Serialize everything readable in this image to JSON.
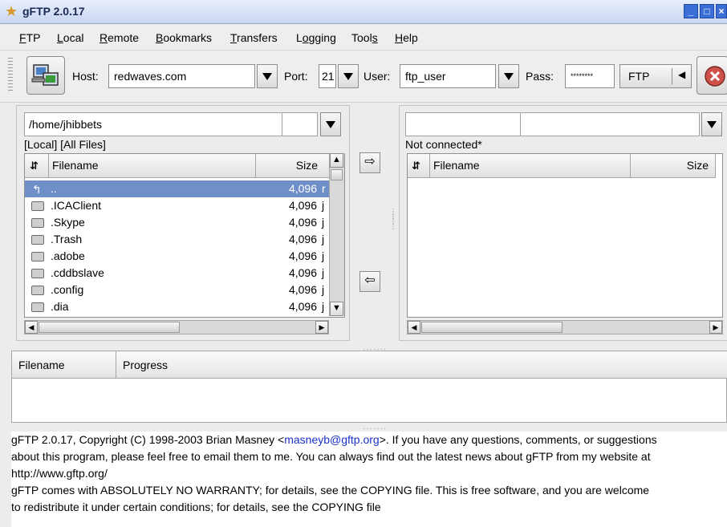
{
  "window": {
    "title": "gFTP 2.0.17",
    "app_icon": "star-icon",
    "buttons": [
      "minimize",
      "maximize",
      "close"
    ]
  },
  "menu": [
    {
      "label": "FTP",
      "key": "F"
    },
    {
      "label": "Local",
      "key": "L"
    },
    {
      "label": "Remote",
      "key": "R"
    },
    {
      "label": "Bookmarks",
      "key": "B"
    },
    {
      "label": "Transfers",
      "key": "T"
    },
    {
      "label": "Logging",
      "key": "o"
    },
    {
      "label": "Tools",
      "key": "s"
    },
    {
      "label": "Help",
      "key": "H"
    }
  ],
  "toolbar": {
    "connect_icon": "computer-connect-icon",
    "host_label": "Host:",
    "host_value": "redwaves.com",
    "port_label": "Port:",
    "port_value": "21",
    "user_label": "User:",
    "user_value": "ftp_user",
    "pass_label": "Pass:",
    "pass_value": "********",
    "protocol": "FTP",
    "stop_icon": "stop-icon"
  },
  "local": {
    "path": "/home/jhibbets",
    "status": "[Local] [All Files]",
    "columns": [
      "Filename",
      "Size"
    ],
    "files": [
      {
        "name": "..",
        "size": "4,096",
        "extra": "r",
        "type": "updir",
        "selected": true
      },
      {
        "name": ".ICAClient",
        "size": "4,096",
        "extra": "j",
        "type": "folder"
      },
      {
        "name": ".Skype",
        "size": "4,096",
        "extra": "j",
        "type": "folder"
      },
      {
        "name": ".Trash",
        "size": "4,096",
        "extra": "j",
        "type": "folder"
      },
      {
        "name": ".adobe",
        "size": "4,096",
        "extra": "j",
        "type": "folder"
      },
      {
        "name": ".cddbslave",
        "size": "4,096",
        "extra": "j",
        "type": "folder"
      },
      {
        "name": ".config",
        "size": "4,096",
        "extra": "j",
        "type": "folder"
      },
      {
        "name": ".dia",
        "size": "4,096",
        "extra": "j",
        "type": "folder"
      }
    ]
  },
  "remote": {
    "path": "",
    "status": "Not connected*",
    "columns": [
      "Filename",
      "Size"
    ]
  },
  "transfer_buttons": {
    "upload_icon": "arrow-right-icon",
    "download_icon": "arrow-left-icon"
  },
  "transfers": {
    "columns": [
      "Filename",
      "Progress"
    ]
  },
  "log": {
    "line1_pre": "gFTP 2.0.17, Copyright (C) 1998-2003 Brian Masney <",
    "email": "masneyb@gftp.org",
    "line1_post": ">. If you have any questions, comments, or suggestions",
    "line2": "about this program, please feel free to email them to me. You can always find out the latest news about gFTP from my website at",
    "line3": "http://www.gftp.org/",
    "line4": "gFTP comes with ABSOLUTELY NO WARRANTY; for details, see the COPYING file. This is free software, and you are welcome",
    "line5": "to redistribute it under certain conditions; for details, see the COPYING file"
  }
}
